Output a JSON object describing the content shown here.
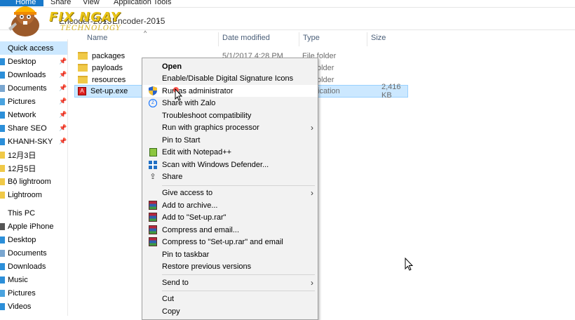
{
  "ribbon": {
    "tabs": [
      "Home",
      "Share",
      "View",
      "Application Tools"
    ]
  },
  "logo": {
    "title": "FIX NGAY",
    "subtitle": "TECHNOLOGY"
  },
  "address": {
    "crumbs": [
      "Encoder-2015",
      "Encoder-2015"
    ],
    "separator": "›"
  },
  "columns": {
    "name": "Name",
    "date": "Date modified",
    "type": "Type",
    "size": "Size"
  },
  "files": [
    {
      "name": "packages",
      "date": "5/1/2017 4:28 PM",
      "type": "File folder",
      "size": ""
    },
    {
      "name": "payloads",
      "date": "",
      "type": "older",
      "size": ""
    },
    {
      "name": "resources",
      "date": "",
      "type": "older",
      "size": ""
    },
    {
      "name": "Set-up.exe",
      "date": "",
      "type": "ication",
      "size": "2,416 KB"
    }
  ],
  "nav": {
    "items": [
      {
        "label": "Quick access",
        "pinned": false
      },
      {
        "label": "Desktop",
        "pinned": true
      },
      {
        "label": "Downloads",
        "pinned": true
      },
      {
        "label": "Documents",
        "pinned": true
      },
      {
        "label": "Pictures",
        "pinned": true
      },
      {
        "label": "Network",
        "pinned": true
      },
      {
        "label": "Share SEO",
        "pinned": true
      },
      {
        "label": "KHANH-SKY",
        "pinned": true
      },
      {
        "label": "12月3日",
        "pinned": false
      },
      {
        "label": "12月5日",
        "pinned": false
      },
      {
        "label": "Bộ lightroom",
        "pinned": false
      },
      {
        "label": "Lightroom",
        "pinned": false
      },
      {
        "label": "This PC",
        "pinned": false
      },
      {
        "label": "Apple iPhone",
        "pinned": false
      },
      {
        "label": "Desktop",
        "pinned": false
      },
      {
        "label": "Documents",
        "pinned": false
      },
      {
        "label": "Downloads",
        "pinned": false
      },
      {
        "label": "Music",
        "pinned": false
      },
      {
        "label": "Pictures",
        "pinned": false
      },
      {
        "label": "Videos",
        "pinned": false
      }
    ]
  },
  "context_menu": {
    "items": [
      {
        "label": "Open",
        "bold": true,
        "icon": ""
      },
      {
        "label": "Enable/Disable Digital Signature Icons",
        "icon": ""
      },
      {
        "label": "Run as administrator",
        "icon": "uac-shield-icon"
      },
      {
        "label": "Share with Zalo",
        "icon": "zalo-icon"
      },
      {
        "label": "Troubleshoot compatibility",
        "icon": ""
      },
      {
        "label": "Run with graphics processor",
        "icon": "",
        "submenu": true
      },
      {
        "label": "Pin to Start",
        "icon": ""
      },
      {
        "label": "Edit with Notepad++",
        "icon": "notepad-plus-icon"
      },
      {
        "label": "Scan with Windows Defender...",
        "icon": "defender-icon"
      },
      {
        "label": "Share",
        "icon": "share-icon"
      },
      {
        "label": "Give access to",
        "icon": "",
        "submenu": true,
        "separator_before": true
      },
      {
        "label": "Add to archive...",
        "icon": "winrar-icon"
      },
      {
        "label": "Add to \"Set-up.rar\"",
        "icon": "winrar-icon"
      },
      {
        "label": "Compress and email...",
        "icon": "winrar-icon"
      },
      {
        "label": "Compress to \"Set-up.rar\" and email",
        "icon": "winrar-icon"
      },
      {
        "label": "Pin to taskbar",
        "icon": ""
      },
      {
        "label": "Restore previous versions",
        "icon": ""
      },
      {
        "label": "Send to",
        "icon": "",
        "submenu": true,
        "separator_before": true
      },
      {
        "label": "Cut",
        "icon": "",
        "separator_before": true
      },
      {
        "label": "Copy",
        "icon": ""
      }
    ]
  },
  "colors": {
    "selection": "#cce8ff",
    "accent": "#1979ca",
    "menu_bg": "#f2f2f2"
  }
}
